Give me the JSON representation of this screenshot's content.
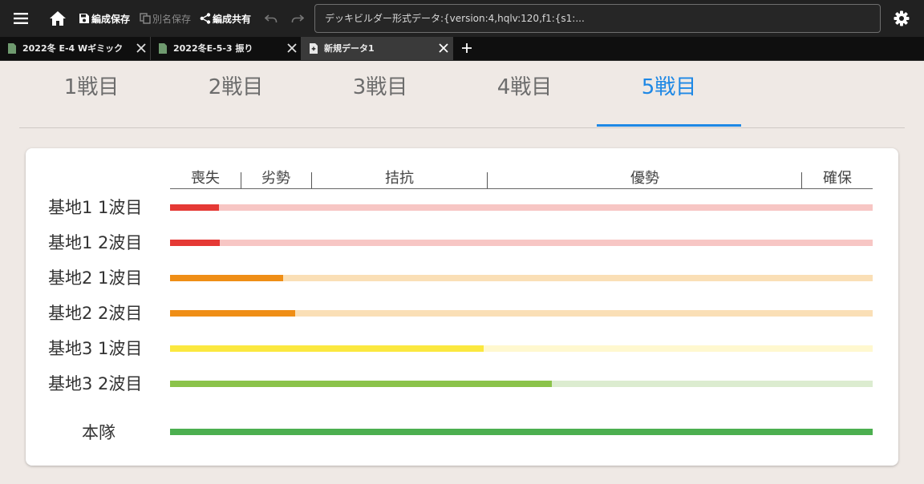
{
  "colors": {
    "accent": "#1e88e5",
    "toolbar_bg": "#212121",
    "lost": "#e53935",
    "lost_light": "#f7c6c4",
    "inferior": "#ef8e16",
    "inferior_light": "#fadfb6",
    "parity": "#fbe83f",
    "parity_light": "#fff8cf",
    "superior": "#8bc34a",
    "superior_light": "#dcecd0",
    "supremacy": "#4caf50"
  },
  "toolbar": {
    "menu_icon": "menu-icon",
    "home_icon": "home-icon",
    "save_label": "編成保存",
    "save_as_label": "別名保存",
    "share_label": "編成共有",
    "export_text": "デッキビルダー形式データ:{version:4,hqlv:120,f1:{s1:..."
  },
  "tabs": [
    {
      "label": "2022冬 E-4 Wギミック",
      "active": false
    },
    {
      "label": "2022冬E-5-3 振り",
      "active": false
    },
    {
      "label": "新規データ1",
      "active": true
    }
  ],
  "battles": [
    {
      "label": "1戦目",
      "active": false
    },
    {
      "label": "2戦目",
      "active": false
    },
    {
      "label": "3戦目",
      "active": false
    },
    {
      "label": "4戦目",
      "active": false
    },
    {
      "label": "5戦目",
      "active": true
    }
  ],
  "air_state": {
    "headers": [
      "喪失",
      "劣勢",
      "拮抗",
      "優勢",
      "確保"
    ],
    "rows": [
      {
        "label": "基地1 1波目",
        "value": 0.07,
        "state": "lost"
      },
      {
        "label": "基地1 2波目",
        "value": 0.071,
        "state": "lost"
      },
      {
        "label": "基地2 1波目",
        "value": 0.161,
        "state": "inferior"
      },
      {
        "label": "基地2 2波目",
        "value": 0.178,
        "state": "inferior"
      },
      {
        "label": "基地3 1波目",
        "value": 0.446,
        "state": "parity"
      },
      {
        "label": "基地3 2波目",
        "value": 0.543,
        "state": "superior"
      }
    ],
    "main": {
      "label": "本隊",
      "value": 1.0,
      "state": "supremacy"
    }
  }
}
